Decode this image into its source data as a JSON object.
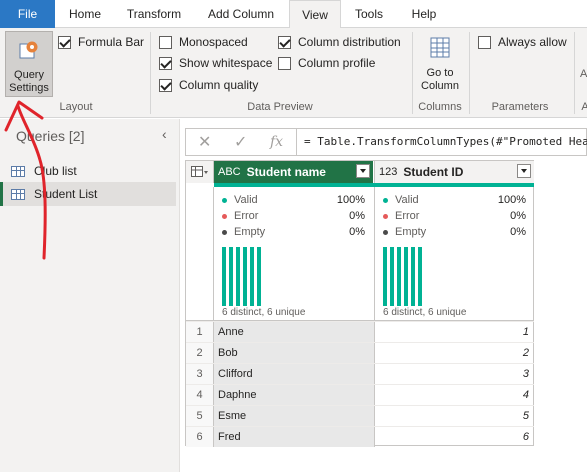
{
  "menu": {
    "tabs": [
      {
        "label": "File"
      },
      {
        "label": "Home"
      },
      {
        "label": "Transform"
      },
      {
        "label": "Add Column"
      },
      {
        "label": "View"
      },
      {
        "label": "Tools"
      },
      {
        "label": "Help"
      }
    ],
    "active": "View",
    "file_color": "#2b78c5"
  },
  "ribbon": {
    "query_settings": "Query Settings",
    "formula_bar": {
      "label": "Formula Bar",
      "checked": true
    },
    "monospaced": {
      "label": "Monospaced",
      "checked": false
    },
    "show_whitespace": {
      "label": "Show whitespace",
      "checked": true
    },
    "column_quality": {
      "label": "Column quality",
      "checked": true
    },
    "column_distribution": {
      "label": "Column distribution",
      "checked": true
    },
    "column_profile": {
      "label": "Column profile",
      "checked": false
    },
    "go_to_column": "Go to Column",
    "always_allow": {
      "label": "Always allow",
      "checked": false
    },
    "overflow_label": "A",
    "groups": {
      "layout": "Layout",
      "data_preview": "Data Preview",
      "columns": "Columns",
      "parameters": "Parameters",
      "overflow": "A"
    }
  },
  "queries": {
    "header": "Queries [2]",
    "items": [
      {
        "label": "Club list",
        "selected": false
      },
      {
        "label": "Student List",
        "selected": true
      }
    ]
  },
  "formula": {
    "cancel_glyph": "✕",
    "confirm_glyph": "✓",
    "fx": "fx",
    "text": "= Table.TransformColumnTypes(#\"Promoted Hea"
  },
  "grid": {
    "accent": "#217346",
    "quality_color": "#00b294",
    "columns": [
      {
        "type_icon": "ABC",
        "name": "Student name",
        "valid_label": "Valid",
        "valid_pct": "100%",
        "error_label": "Error",
        "error_pct": "0%",
        "empty_label": "Empty",
        "empty_pct": "0%",
        "distinct": "6 distinct, 6 unique"
      },
      {
        "type_icon": "123",
        "name": "Student ID",
        "valid_label": "Valid",
        "valid_pct": "100%",
        "error_label": "Error",
        "error_pct": "0%",
        "empty_label": "Empty",
        "empty_pct": "0%",
        "distinct": "6 distinct, 6 unique"
      }
    ],
    "rows": [
      {
        "n": "1",
        "name": "Anne",
        "id": "1"
      },
      {
        "n": "2",
        "name": "Bob",
        "id": "2"
      },
      {
        "n": "3",
        "name": "Clifford",
        "id": "3"
      },
      {
        "n": "4",
        "name": "Daphne",
        "id": "4"
      },
      {
        "n": "5",
        "name": "Esme",
        "id": "5"
      },
      {
        "n": "6",
        "name": "Fred",
        "id": "6"
      }
    ],
    "status_colors": {
      "valid": "#00b294",
      "error": "#e55a5a",
      "empty": "#4a4a4a"
    }
  },
  "annotation": {
    "color": "#e0242b"
  }
}
